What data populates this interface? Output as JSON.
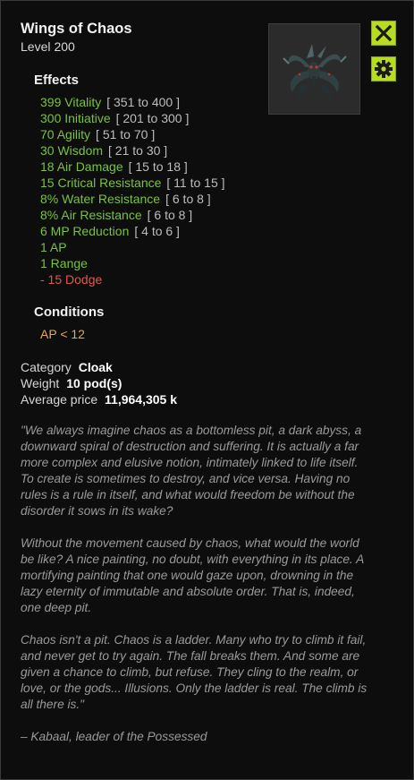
{
  "item": {
    "name": "Wings of Chaos",
    "level_label": "Level",
    "level": "200",
    "image_alt": "wings-of-chaos-icon"
  },
  "effects": {
    "heading": "Effects",
    "list": [
      {
        "value": "399 Vitality",
        "range": "[ 351 to 400 ]",
        "negative": false
      },
      {
        "value": "300 Initiative",
        "range": "[ 201 to 300 ]",
        "negative": false
      },
      {
        "value": "70 Agility",
        "range": "[ 51 to 70 ]",
        "negative": false
      },
      {
        "value": "30 Wisdom",
        "range": "[ 21 to 30 ]",
        "negative": false
      },
      {
        "value": "18 Air Damage",
        "range": "[ 15 to 18 ]",
        "negative": false
      },
      {
        "value": "15 Critical Resistance",
        "range": "[ 11 to 15 ]",
        "negative": false
      },
      {
        "value": "8% Water Resistance",
        "range": "[ 6 to 8 ]",
        "negative": false
      },
      {
        "value": "8% Air Resistance",
        "range": "[ 6 to 8 ]",
        "negative": false
      },
      {
        "value": "6 MP Reduction",
        "range": "[ 4 to 6 ]",
        "negative": false
      },
      {
        "value": "1 AP",
        "range": "",
        "negative": false
      },
      {
        "value": "1 Range",
        "range": "",
        "negative": false
      },
      {
        "value": "- 15 Dodge",
        "range": "",
        "negative": true
      }
    ]
  },
  "conditions": {
    "heading": "Conditions",
    "value": "AP < 12"
  },
  "info": {
    "category_label": "Category",
    "category": "Cloak",
    "weight_label": "Weight",
    "weight": "10 pod(s)",
    "price_label": "Average price",
    "price": "11,964,305 k"
  },
  "description": {
    "p1": "\"We always imagine chaos as a bottomless pit, a dark abyss, a downward spiral of destruction and suffering. It is actually a far more complex and elusive notion, intimately linked to life itself. To create is sometimes to destroy, and vice versa. Having no rules is a rule in itself, and what would freedom be without the disorder it sows in its wake?",
    "p2": "Without the movement caused by chaos, what would the world be like? A nice painting, no doubt, with everything in its place. A mortifying painting that one would gaze upon, drowning in the lazy eternity of immutable and absolute order. That is, indeed, one deep pit.",
    "p3": "Chaos isn't a pit. Chaos is a ladder. Many who try to climb it fail, and never get to try again. The fall breaks them. And some are given a chance to climb, but refuse. They cling to the realm, or love, or the gods... Illusions. Only the ladder is real. The climb is all there is.\"",
    "p4": "– Kabaal, leader of the Possessed"
  },
  "buttons": {
    "close_icon": "close-icon",
    "settings_icon": "gear-icon"
  },
  "colors": {
    "accent": "#b8dc1f",
    "positive_effect": "#7bc043",
    "negative_effect": "#d95b4e",
    "condition": "#e0a85a"
  }
}
